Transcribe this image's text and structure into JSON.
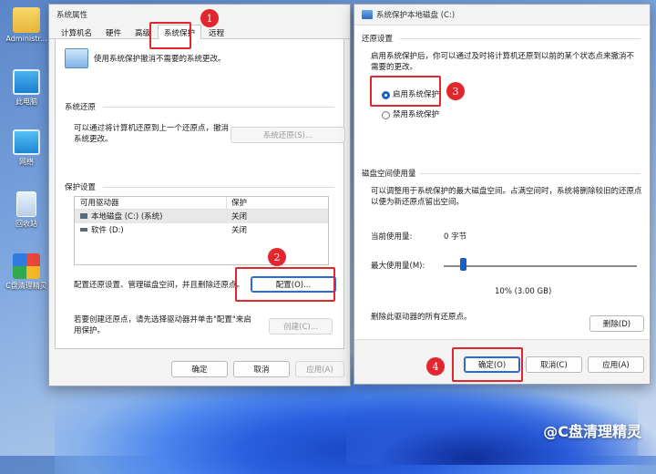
{
  "desktop": {
    "icons": [
      {
        "label": "Administr..."
      },
      {
        "label": "此电脑"
      },
      {
        "label": "网络"
      },
      {
        "label": "回收站"
      },
      {
        "label": "C盘清理精灵"
      }
    ]
  },
  "left_window": {
    "title": "系统属性",
    "tabs": [
      "计算机名",
      "硬件",
      "高级",
      "系统保护",
      "远程"
    ],
    "active_tab": "系统保护",
    "intro_text": "使用系统保护撤消不需要的系统更改。",
    "restore_section": {
      "heading": "系统还原",
      "text": "可以通过将计算机还原到上一个还原点，撤消系统更改。",
      "button": "系统还原(S)..."
    },
    "protection_section": {
      "heading": "保护设置",
      "columns": [
        "可用驱动器",
        "保护"
      ],
      "rows": [
        {
          "drive": "本地磁盘 (C:) (系统)",
          "status": "关闭"
        },
        {
          "drive": "软件 (D:)",
          "status": "关闭"
        }
      ]
    },
    "configure_text": "配置还原设置、管理磁盘空间，并且删除还原点。",
    "configure_button": "配置(O)...",
    "create_text": "若要创建还原点，请先选择驱动器并单击\"配置\"来启用保护。",
    "create_button": "创建(C)...",
    "footer": {
      "ok": "确定",
      "cancel": "取消",
      "apply": "应用(A)"
    }
  },
  "right_window": {
    "title": "系统保护本地磁盘 (C:)",
    "restore_settings": {
      "heading": "还原设置",
      "text": "启用系统保护后，你可以通过及时将计算机还原到以前的某个状态点来撤消不需要的更改。",
      "option_on": "启用系统保护",
      "option_off": "禁用系统保护",
      "selected": "启用系统保护"
    },
    "disk_usage": {
      "heading": "磁盘空间使用量",
      "text": "可以调整用于系统保护的最大磁盘空间。占满空间时，系统将删除较旧的还原点以便为新还原点留出空间。",
      "current_label": "当前使用量:",
      "current_value": "0 字节",
      "max_label": "最大使用量(M):",
      "slider_fraction": 0.1,
      "slider_value": "10% (3.00 GB)"
    },
    "delete_text": "删除此驱动器的所有还原点。",
    "delete_button": "删除(D)",
    "footer": {
      "ok": "确定(O)",
      "cancel": "取消(C)",
      "apply": "应用(A)"
    }
  },
  "annotations": [
    "1",
    "2",
    "3",
    "4"
  ],
  "watermark": "@C盘清理精灵",
  "colors": {
    "annotation_red": "#e2262d",
    "accent_blue": "#1a5fc8"
  }
}
